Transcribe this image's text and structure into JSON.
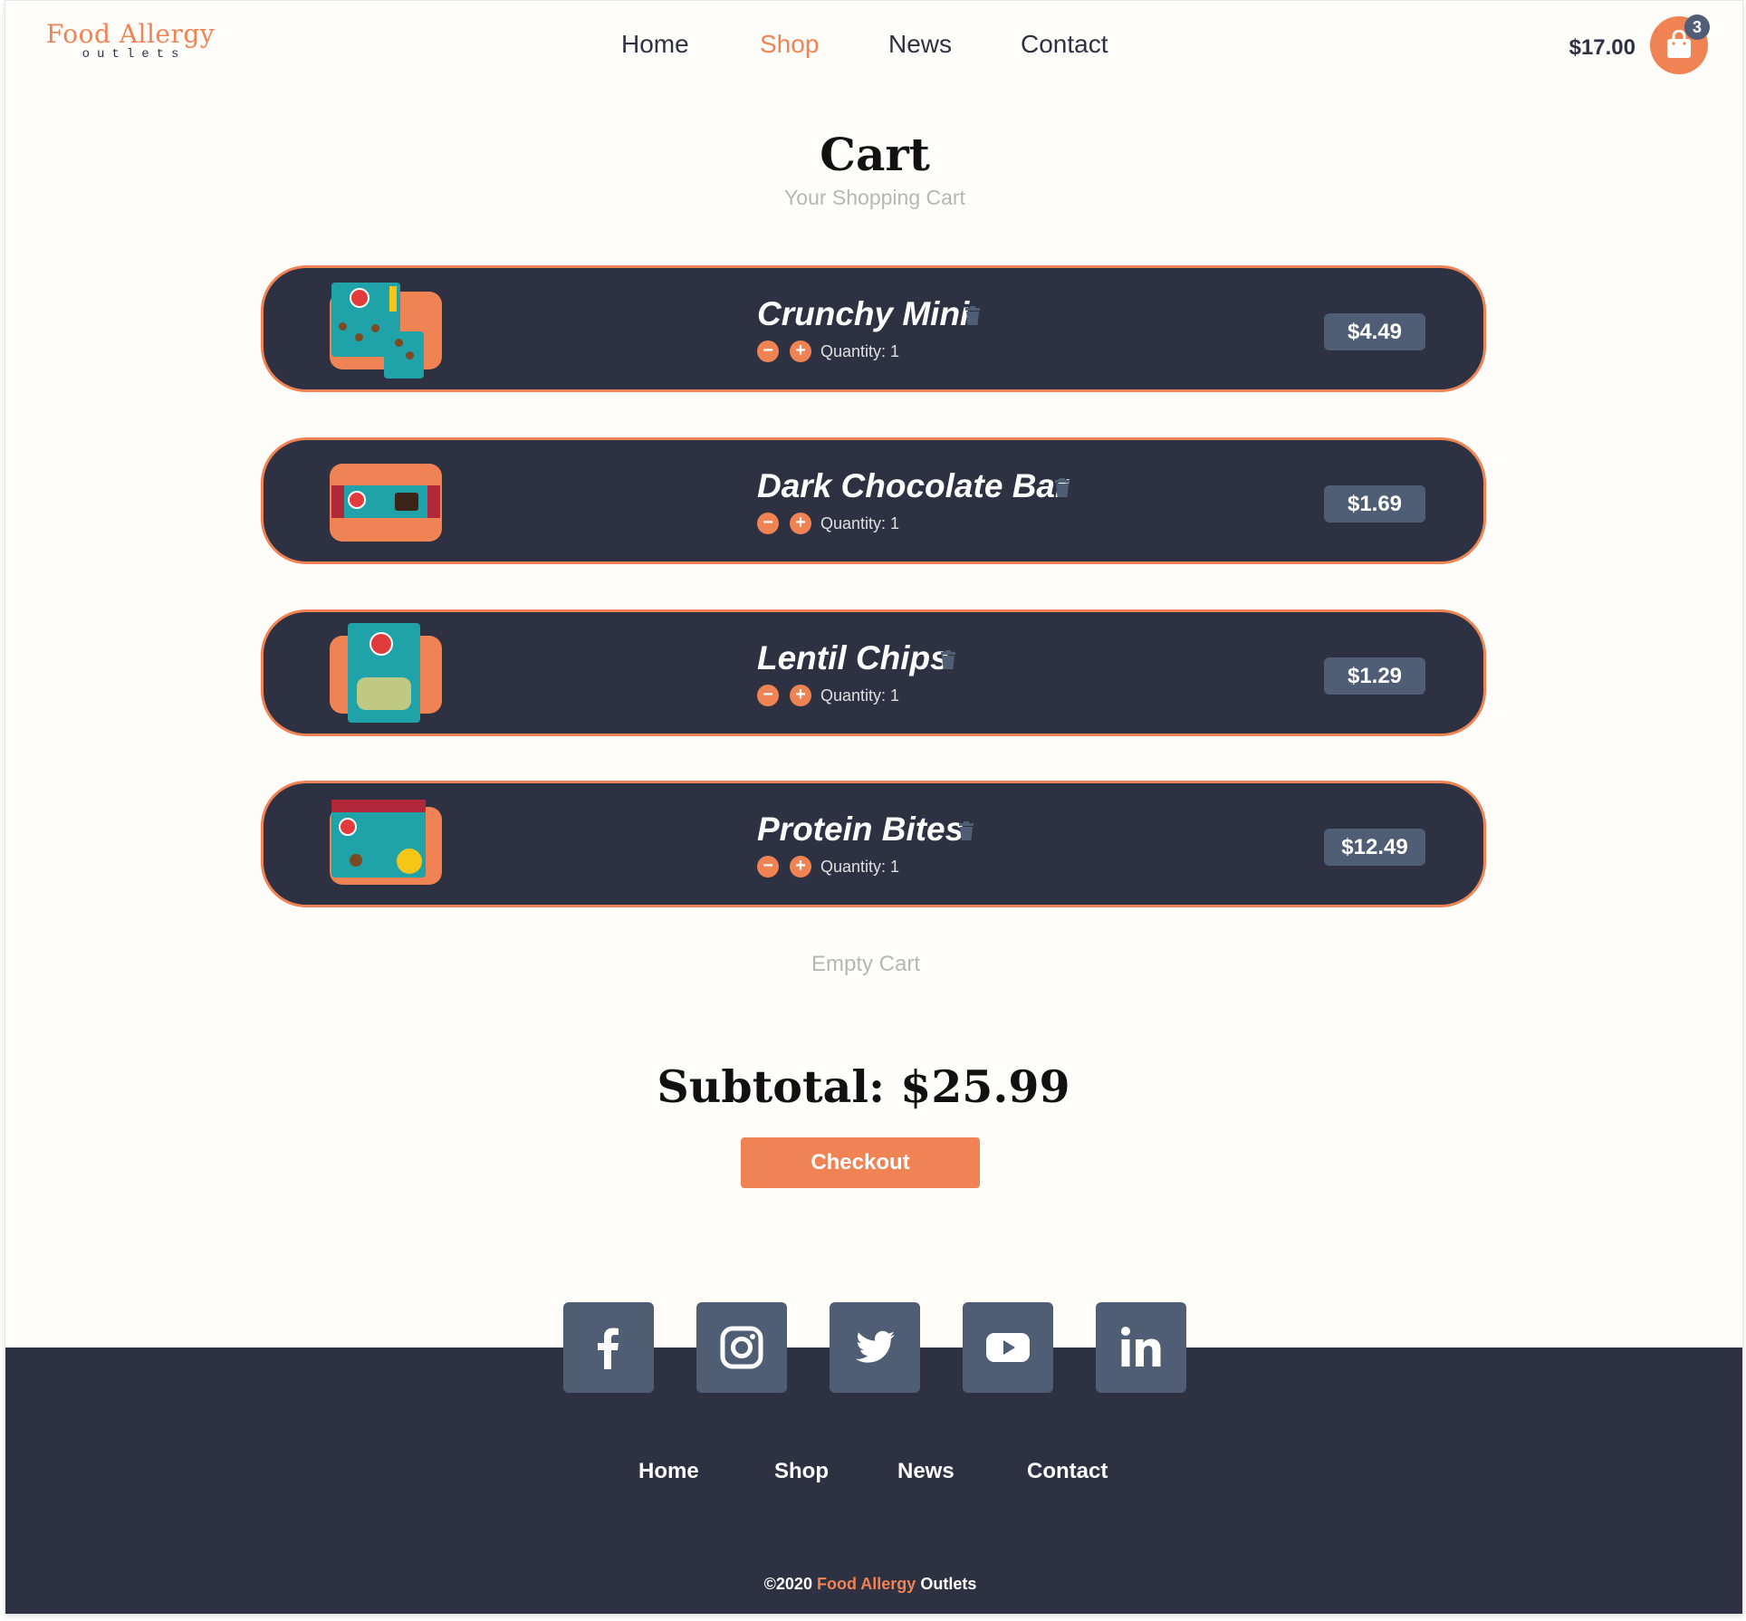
{
  "brand": {
    "name": "Food Allergy",
    "tagline": "outlets",
    "color_primary": "#ef8354",
    "color_dark": "#2d3142",
    "color_slate": "#4f5d75"
  },
  "nav": {
    "items": [
      {
        "label": "Home",
        "active": false
      },
      {
        "label": "Shop",
        "active": true
      },
      {
        "label": "News",
        "active": false
      },
      {
        "label": "Contact",
        "active": false
      }
    ]
  },
  "header_cart": {
    "total": "$17.00",
    "count": "3",
    "icon": "shopping-bag-icon"
  },
  "page": {
    "title": "Cart",
    "subtitle": "Your Shopping Cart"
  },
  "cart": {
    "items": [
      {
        "name": "Crunchy Mini",
        "quantity_label": "Quantity: 1",
        "price": "$4.49"
      },
      {
        "name": "Dark Chocolate Bar",
        "quantity_label": "Quantity: 1",
        "price": "$1.69"
      },
      {
        "name": "Lentil Chips",
        "quantity_label": "Quantity: 1",
        "price": "$1.29"
      },
      {
        "name": "Protein Bites",
        "quantity_label": "Quantity: 1",
        "price": "$12.49"
      }
    ],
    "decrease_symbol": "−",
    "increase_symbol": "+",
    "empty_label": "Empty Cart",
    "subtotal": "Subtotal: $25.99",
    "checkout_label": "Checkout"
  },
  "footer": {
    "social": [
      "facebook-icon",
      "instagram-icon",
      "twitter-icon",
      "youtube-icon",
      "linkedin-icon"
    ],
    "nav": [
      "Home",
      "Shop",
      "News",
      "Contact"
    ],
    "copyright_year": "2020",
    "copyright_brand": "Food Allergy",
    "copyright_suffix": "Outlets"
  }
}
